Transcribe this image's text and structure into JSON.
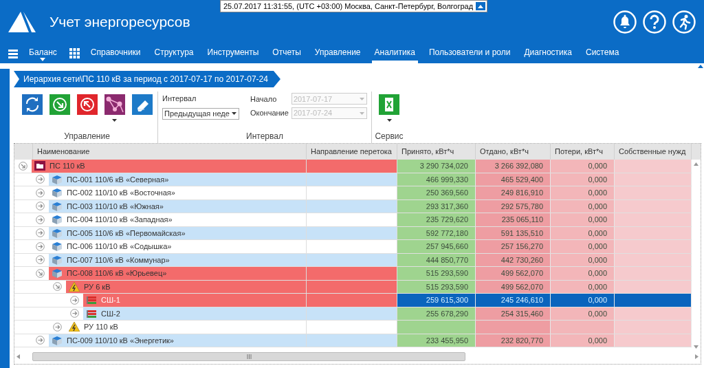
{
  "header": {
    "datetime": "25.07.2017 11:31:55, (UTC +03:00) Москва, Санкт-Петербург, Волгоград",
    "title": "Учет энергоресурсов"
  },
  "nav": [
    {
      "label": "Баланс",
      "selected": false,
      "has_menu": true
    },
    {
      "label": "Справочники",
      "selected": false,
      "has_menu": false
    },
    {
      "label": "Структура",
      "selected": false,
      "has_menu": false
    },
    {
      "label": "Инструменты",
      "selected": false,
      "has_menu": false
    },
    {
      "label": "Отчеты",
      "selected": false,
      "has_menu": false
    },
    {
      "label": "Управление",
      "selected": false,
      "has_menu": false
    },
    {
      "label": "Аналитика",
      "selected": true,
      "has_menu": false
    },
    {
      "label": "Пользователи и роли",
      "selected": false,
      "has_menu": false
    },
    {
      "label": "Диагностика",
      "selected": false,
      "has_menu": false
    },
    {
      "label": "Система",
      "selected": false,
      "has_menu": false
    }
  ],
  "breadcrumb": "Иерархия сети\\ПС 110 кВ за период с 2017-07-17 по 2017-07-24",
  "toolbar": {
    "management": {
      "label": "Управление",
      "buttons": [
        {
          "kind": "refresh",
          "has_menu": false
        },
        {
          "kind": "import",
          "has_menu": false
        },
        {
          "kind": "export",
          "has_menu": false
        },
        {
          "kind": "graph",
          "has_menu": true
        },
        {
          "kind": "edit",
          "has_menu": false
        }
      ]
    },
    "interval": {
      "label": "Интервал",
      "interval_label": "Интервал",
      "interval_value": "Предыдущая неде",
      "start_label": "Начало",
      "start_value": "2017-07-17",
      "end_label": "Окончание",
      "end_value": "2017-07-24",
      "dates_disabled": true
    },
    "service": {
      "label": "Сервис",
      "buttons": [
        {
          "kind": "excel",
          "has_menu": true
        }
      ]
    }
  },
  "table": {
    "columns": [
      "Наименование",
      "Направление перетока",
      "Принято, кВт*ч",
      "Отдано, кВт*ч",
      "Потери, кВт*ч",
      "Собственные нужд"
    ],
    "rows": [
      {
        "name": "ПС 110 кВ",
        "kind": "folder",
        "expanded": true,
        "alert": true,
        "selected": false,
        "received": "3 290 734,020",
        "sent": "3 266 392,080",
        "losses": "0,000",
        "children": [
          {
            "name": "ПС-001 110/6 кВ «Северная»",
            "kind": "substation",
            "expanded": false,
            "alert": false,
            "selected": false,
            "received": "466 999,330",
            "sent": "465 529,400",
            "losses": "0,000"
          },
          {
            "name": "ПС-002 110/10 кВ «Восточная»",
            "kind": "substation",
            "expanded": false,
            "alert": false,
            "selected": false,
            "received": "250 369,560",
            "sent": "249 816,910",
            "losses": "0,000"
          },
          {
            "name": "ПС-003 110/10 кВ «Южная»",
            "kind": "substation",
            "expanded": false,
            "alert": false,
            "selected": false,
            "received": "293 317,360",
            "sent": "292 575,780",
            "losses": "0,000"
          },
          {
            "name": "ПС-004 110/10 кВ «Западная»",
            "kind": "substation",
            "expanded": false,
            "alert": false,
            "selected": false,
            "received": "235 729,620",
            "sent": "235 065,110",
            "losses": "0,000"
          },
          {
            "name": "ПС-005 110/6 кВ «Первомайская»",
            "kind": "substation",
            "expanded": false,
            "alert": false,
            "selected": false,
            "received": "592 772,180",
            "sent": "591 135,510",
            "losses": "0,000"
          },
          {
            "name": "ПС-006 110/10 кВ «Содышка»",
            "kind": "substation",
            "expanded": false,
            "alert": false,
            "selected": false,
            "received": "257 945,660",
            "sent": "257 156,270",
            "losses": "0,000"
          },
          {
            "name": "ПС-007 110/6 кВ «Коммунар»",
            "kind": "substation",
            "expanded": false,
            "alert": false,
            "selected": false,
            "received": "444 850,770",
            "sent": "442 730,260",
            "losses": "0,000"
          },
          {
            "name": "ПС-008 110/6 кВ «Юрьевец»",
            "kind": "substation",
            "expanded": true,
            "alert": true,
            "selected": false,
            "received": "515 293,590",
            "sent": "499 562,070",
            "losses": "0,000",
            "children": [
              {
                "name": "РУ 6 кВ",
                "kind": "switchgear",
                "expanded": true,
                "alert": true,
                "selected": false,
                "received": "515 293,590",
                "sent": "499 562,070",
                "losses": "0,000",
                "children": [
                  {
                    "name": "СШ-1",
                    "kind": "busbar",
                    "expanded": false,
                    "alert": true,
                    "selected": true,
                    "received": "259 615,300",
                    "sent": "245 246,610",
                    "losses": "0,000"
                  },
                  {
                    "name": "СШ-2",
                    "kind": "busbar",
                    "expanded": false,
                    "alert": false,
                    "selected": false,
                    "received": "255 678,290",
                    "sent": "254 315,460",
                    "losses": "0,000"
                  }
                ]
              },
              {
                "name": "РУ 110 кВ",
                "kind": "switchgear",
                "expanded": false,
                "alert": false,
                "selected": false
              }
            ]
          },
          {
            "name": "ПС-009 110/10 кВ «Энергетик»",
            "kind": "substation",
            "expanded": false,
            "alert": false,
            "selected": false,
            "received": "233 455,950",
            "sent": "232 820,770",
            "losses": "0,000"
          }
        ]
      }
    ]
  }
}
